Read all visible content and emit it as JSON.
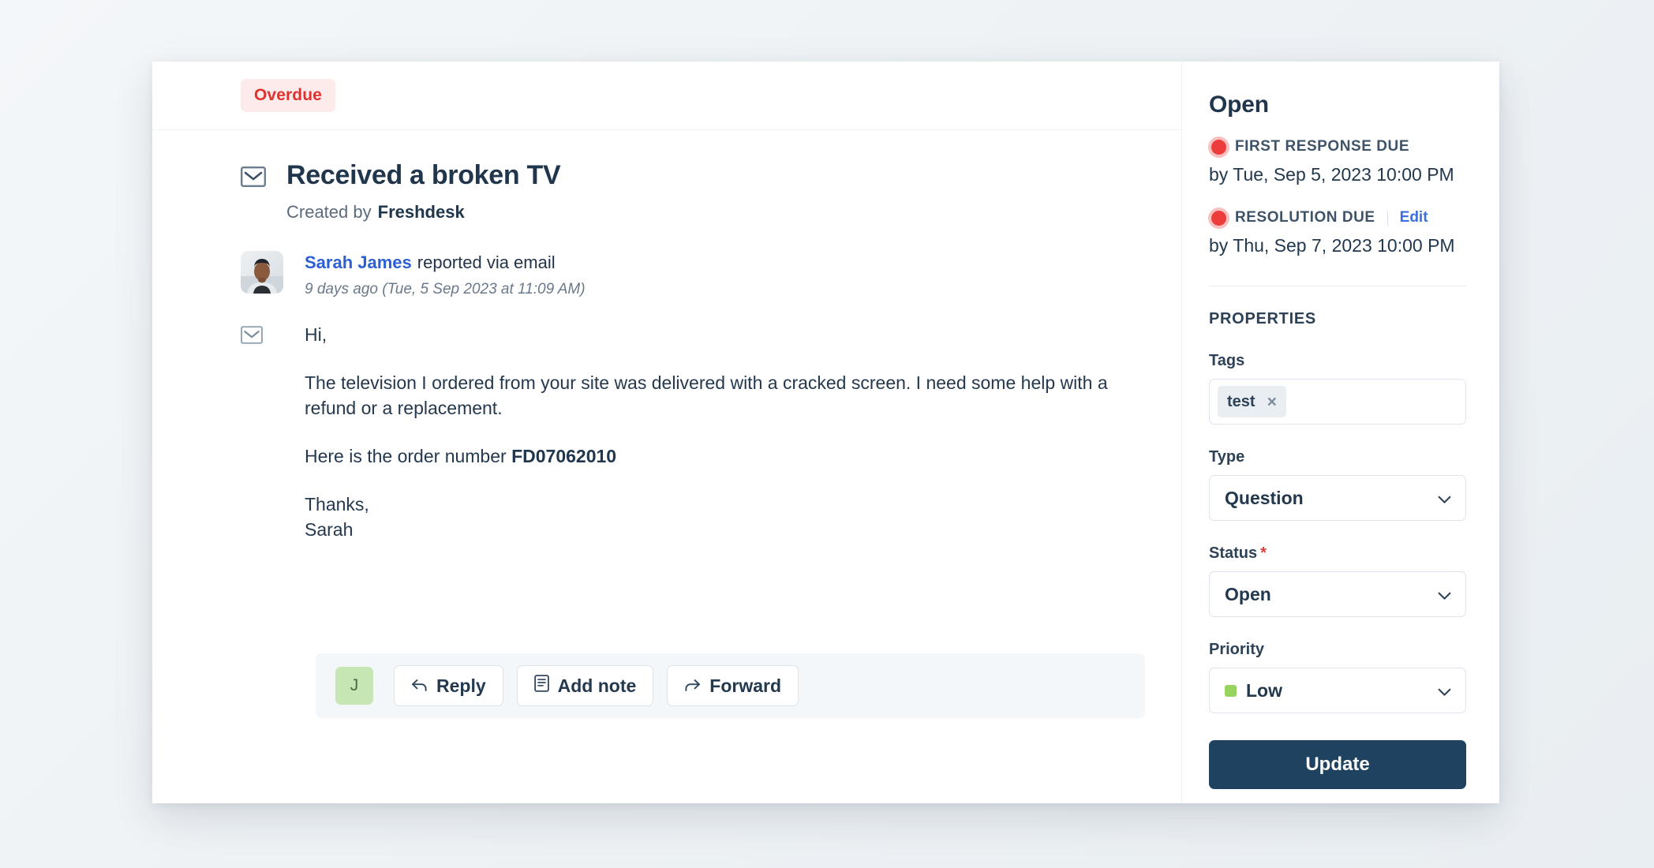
{
  "ticket": {
    "badge": "Overdue",
    "title": "Received a broken TV",
    "created_by_label": "Created by",
    "created_by": "Freshdesk",
    "mail_icon": "envelope-icon"
  },
  "reporter": {
    "name": "Sarah James",
    "action": "reported via email",
    "timestamp": "9 days ago (Tue, 5 Sep 2023 at 11:09 AM)"
  },
  "message": {
    "greeting": "Hi,",
    "paragraph": "The television I ordered from your site was delivered with a cracked screen. I need some help with a refund or a replacement.",
    "order_prefix": "Here is the order number",
    "order_number": "FD07062010",
    "signoff": "Thanks,",
    "signer": "Sarah"
  },
  "actions": {
    "agent_initial": "J",
    "buttons": [
      {
        "label": "Reply",
        "icon": "reply-arrow-icon"
      },
      {
        "label": "Add note",
        "icon": "note-document-icon"
      },
      {
        "label": "Forward",
        "icon": "forward-arrow-icon"
      }
    ]
  },
  "sidebar": {
    "status_heading": "Open",
    "sla": [
      {
        "label": "FIRST RESPONSE DUE",
        "date": "by Tue, Sep 5, 2023 10:00 PM",
        "edit_label": "",
        "has_edit": false
      },
      {
        "label": "RESOLUTION DUE",
        "date": "by Thu, Sep 7, 2023 10:00 PM",
        "edit_label": "Edit",
        "has_edit": true
      }
    ],
    "properties_heading": "PROPERTIES",
    "tags": {
      "label": "Tags",
      "chips": [
        {
          "text": "test",
          "remove_icon": "×"
        }
      ]
    },
    "type": {
      "label": "Type",
      "value": "Question"
    },
    "status": {
      "label": "Status",
      "required_mark": "*",
      "value": "Open"
    },
    "priority": {
      "label": "Priority",
      "value": "Low",
      "swatch_color": "#97d45f"
    },
    "update_label": "Update"
  },
  "colors": {
    "badge_bg": "#fdeaea",
    "badge_text": "#e0312f",
    "link": "#2c5fd4",
    "sla_dot": "#ec3c3c",
    "primary_button": "#1e4260",
    "agent_avatar_bg": "#c6e6b4"
  }
}
